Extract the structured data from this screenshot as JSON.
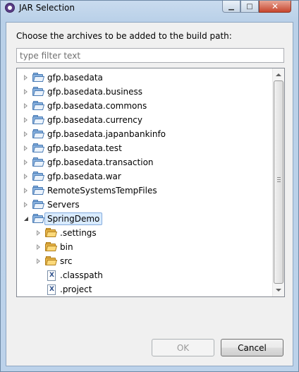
{
  "window": {
    "title": "JAR Selection",
    "minimize_glyph": "▁",
    "maximize_glyph": "□",
    "close_glyph": "✕"
  },
  "dialog": {
    "prompt": "Choose the archives to be added to the build path:",
    "filter_placeholder": "type filter text",
    "filter_value": ""
  },
  "tree": {
    "items": [
      {
        "label": "gfp.basedata",
        "icon": "project-folder-icon",
        "state": "collapsed",
        "depth": 0
      },
      {
        "label": "gfp.basedata.business",
        "icon": "project-folder-icon",
        "state": "collapsed",
        "depth": 0
      },
      {
        "label": "gfp.basedata.commons",
        "icon": "project-folder-icon",
        "state": "collapsed",
        "depth": 0
      },
      {
        "label": "gfp.basedata.currency",
        "icon": "project-folder-icon",
        "state": "collapsed",
        "depth": 0
      },
      {
        "label": "gfp.basedata.japanbankinfo",
        "icon": "project-folder-icon",
        "state": "collapsed",
        "depth": 0
      },
      {
        "label": "gfp.basedata.test",
        "icon": "project-folder-icon",
        "state": "collapsed",
        "depth": 0
      },
      {
        "label": "gfp.basedata.transaction",
        "icon": "project-folder-icon",
        "state": "collapsed",
        "depth": 0
      },
      {
        "label": "gfp.basedata.war",
        "icon": "project-folder-icon",
        "state": "collapsed",
        "depth": 0
      },
      {
        "label": "RemoteSystemsTempFiles",
        "icon": "project-folder-icon",
        "state": "collapsed",
        "depth": 0
      },
      {
        "label": "Servers",
        "icon": "project-folder-icon",
        "state": "collapsed",
        "depth": 0
      },
      {
        "label": "SpringDemo",
        "icon": "project-folder-icon",
        "state": "expanded",
        "depth": 0,
        "selected": true
      },
      {
        "label": ".settings",
        "icon": "folder-icon",
        "state": "collapsed",
        "depth": 1
      },
      {
        "label": "bin",
        "icon": "folder-icon",
        "state": "collapsed",
        "depth": 1
      },
      {
        "label": "src",
        "icon": "folder-icon",
        "state": "collapsed",
        "depth": 1
      },
      {
        "label": ".classpath",
        "icon": "xml-file-icon",
        "state": "none",
        "depth": 1
      },
      {
        "label": ".project",
        "icon": "xml-file-icon",
        "state": "none",
        "depth": 1
      }
    ]
  },
  "buttons": {
    "ok": "OK",
    "ok_enabled": false,
    "cancel": "Cancel"
  },
  "colors": {
    "selection_bg": "#d9ebff",
    "selection_border": "#84acdd",
    "project_folder": "#8ab3e0",
    "folder": "#e8b547"
  }
}
